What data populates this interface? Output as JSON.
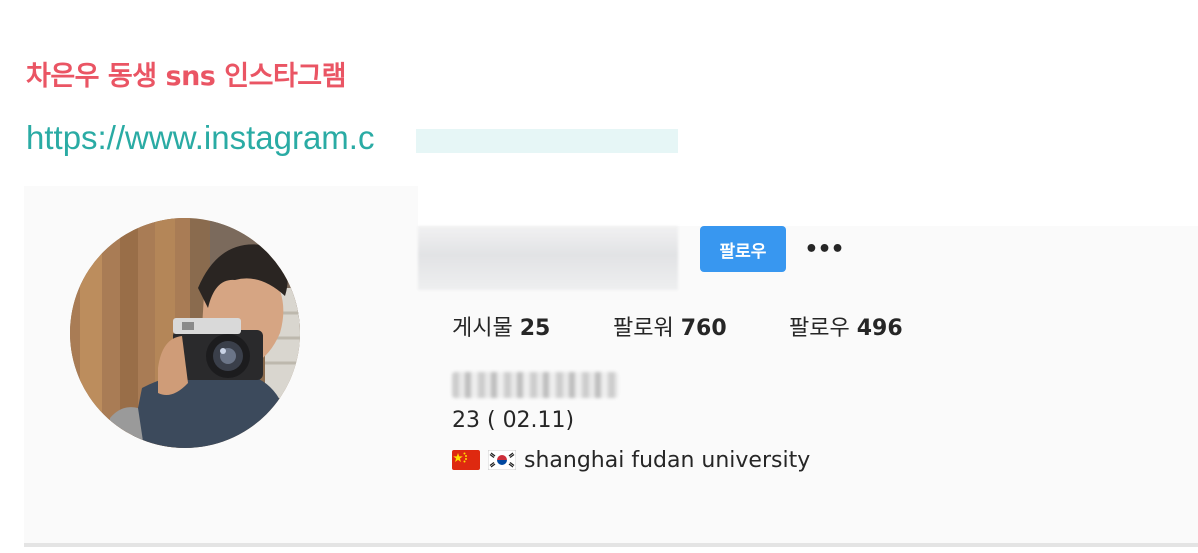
{
  "post": {
    "heading": "차은우 동생 sns 인스타그램",
    "link_text": "https://www.instagram.c"
  },
  "profile": {
    "follow_label": "팔로우",
    "more_label": "•••",
    "stats": [
      {
        "label": "게시물",
        "value": "25"
      },
      {
        "label": "팔로워",
        "value": "760"
      },
      {
        "label": "팔로우",
        "value": "496"
      }
    ],
    "age_line": "23 ( 02.11)",
    "school_line": "shanghai fudan university"
  },
  "icons": {
    "flags": [
      "china-flag-icon",
      "korea-flag-icon"
    ],
    "more": "ellipsis-icon"
  },
  "colors": {
    "heading": "#ea5564",
    "link": "#2aaba4",
    "follow_button": "#3897f0",
    "card_background": "#fafafa"
  }
}
